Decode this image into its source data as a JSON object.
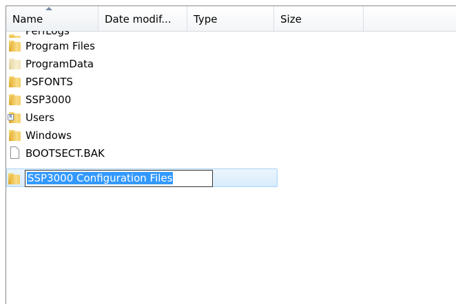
{
  "columns": {
    "name": "Name",
    "date_modified": "Date modif...",
    "type": "Type",
    "size": "Size"
  },
  "items": [
    {
      "label": "PerfLogs",
      "icon": "folder-icon"
    },
    {
      "label": "Program Files",
      "icon": "folder-icon"
    },
    {
      "label": "ProgramData",
      "icon": "folder-icon"
    },
    {
      "label": "PSFONTS",
      "icon": "folder-icon"
    },
    {
      "label": "SSP3000",
      "icon": "folder-icon"
    },
    {
      "label": "Users",
      "icon": "users-folder-icon"
    },
    {
      "label": "Windows",
      "icon": "folder-icon"
    },
    {
      "label": "BOOTSECT.BAK",
      "icon": "file-icon"
    }
  ],
  "rename": {
    "value": "SSP3000 Configuration Files"
  },
  "colors": {
    "selection": "#3399ff",
    "row_highlight": "#d8ecfb"
  }
}
